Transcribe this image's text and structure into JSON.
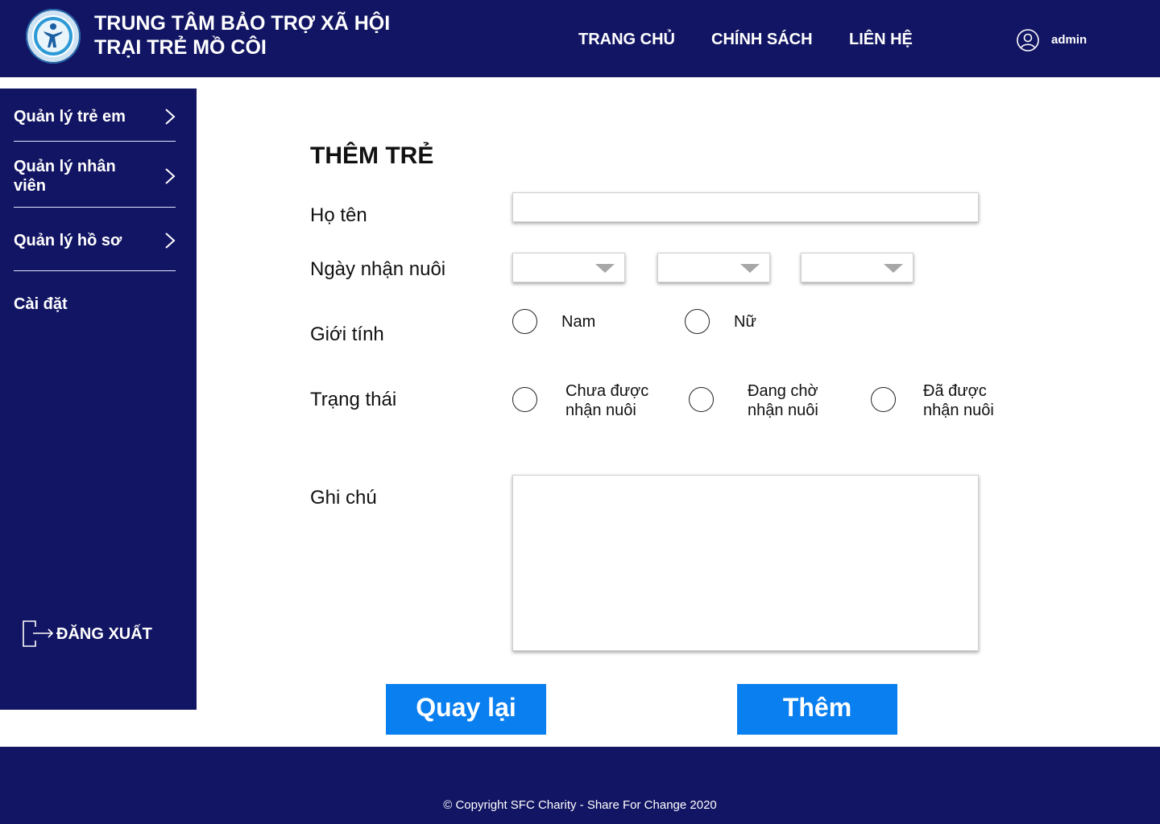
{
  "header": {
    "org_line1": "TRUNG TÂM BẢO TRỢ XÃ HỘI",
    "org_line2": "TRẠI TRẺ MỒ CÔI",
    "nav": {
      "home": "TRANG CHỦ",
      "policy": "CHÍNH SÁCH",
      "contact": "LIÊN HỆ"
    },
    "user": "admin"
  },
  "sidebar": {
    "items": [
      {
        "label": "Quản lý trẻ em"
      },
      {
        "label": "Quản lý nhân viên"
      },
      {
        "label": "Quản lý hồ sơ"
      },
      {
        "label": "Cài đặt"
      }
    ],
    "logout": "ĐĂNG XUẤT"
  },
  "form": {
    "title": "THÊM TRẺ",
    "name_label": "Họ tên",
    "name_value": "",
    "date_label": "Ngày nhận nuôi",
    "date_day": "",
    "date_month": "",
    "date_year": "",
    "gender_label": "Giới tính",
    "gender_options": [
      "Nam",
      "Nữ"
    ],
    "status_label": "Trạng thái",
    "status_options": [
      {
        "line1": "Chưa được",
        "line2": "nhận nuôi"
      },
      {
        "line1": "Đang chờ",
        "line2": "nhận nuôi"
      },
      {
        "line1": "Đã được",
        "line2": "nhận nuôi"
      }
    ],
    "notes_label": "Ghi chú",
    "notes_value": "",
    "back_button": "Quay lại",
    "add_button": "Thêm"
  },
  "footer": {
    "copyright": "© Copyright SFC Charity - Share For Change 2020"
  },
  "colors": {
    "navy": "#121563",
    "button_blue": "#0a7ff0",
    "white": "#ffffff"
  }
}
